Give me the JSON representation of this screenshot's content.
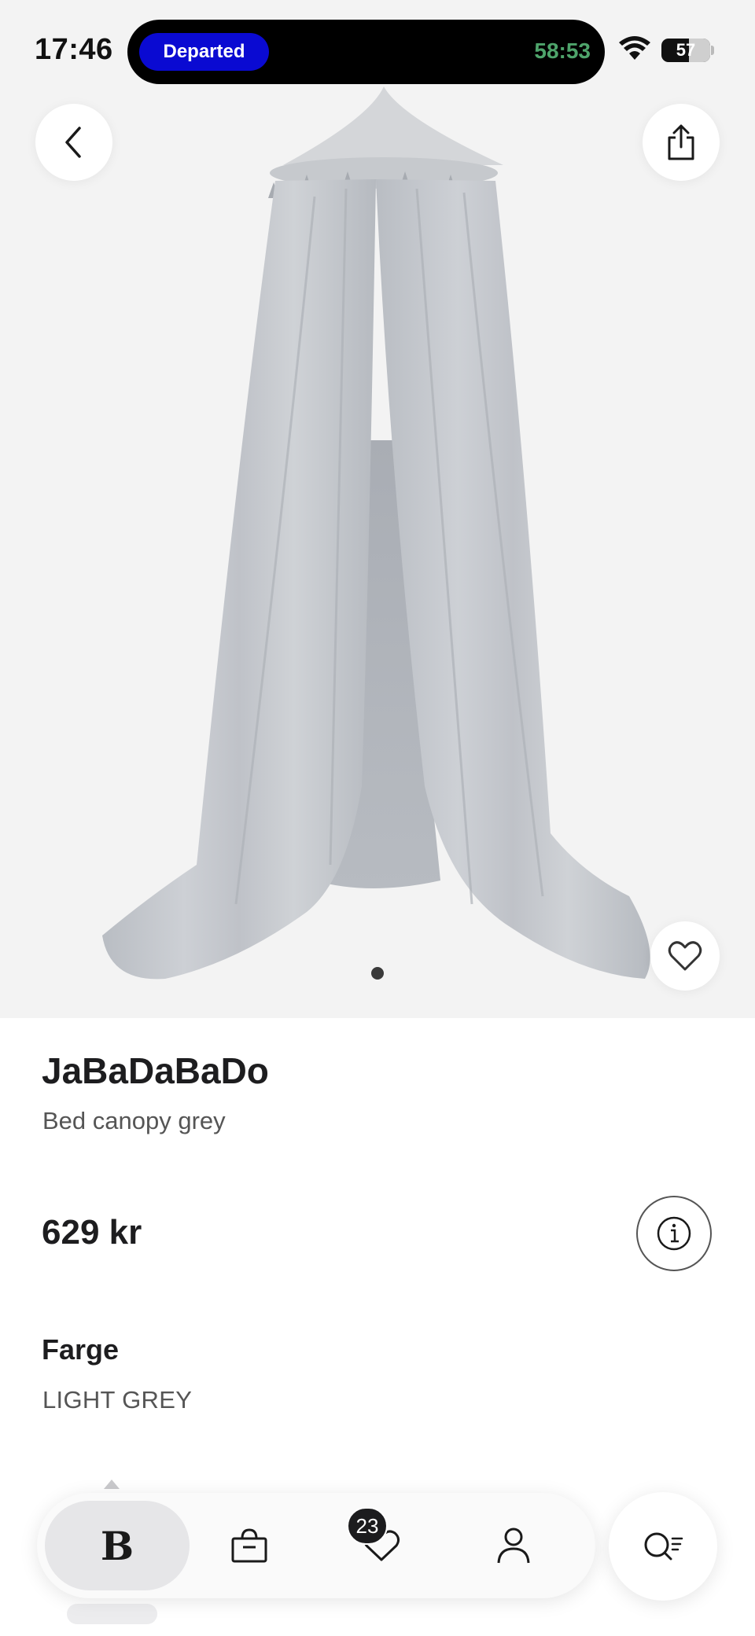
{
  "status_bar": {
    "time": "17:46",
    "live_activity_label": "Departed",
    "live_activity_timer": "58:53",
    "battery_level": "57",
    "battery_fraction": 0.57
  },
  "product": {
    "brand": "JaBaDaBaDo",
    "name": "Bed canopy grey",
    "price": "629 kr",
    "color_heading": "Farge",
    "color_value": "LIGHT GREY"
  },
  "gallery": {
    "image_count": 1,
    "active_index": 0
  },
  "nav": {
    "home_logo": "B",
    "wishlist_count": "23"
  },
  "colors": {
    "live_activity_pill": "#0a0ad2",
    "timer_green": "#4ea46b",
    "hero_background": "#f3f3f3",
    "canopy_fabric": "#c4c7cc"
  },
  "icons": [
    "back-chevron-icon",
    "share-icon",
    "heart-icon",
    "info-icon",
    "bag-icon",
    "heart-icon",
    "person-icon",
    "search-filter-icon",
    "wifi-icon",
    "battery-icon"
  ]
}
